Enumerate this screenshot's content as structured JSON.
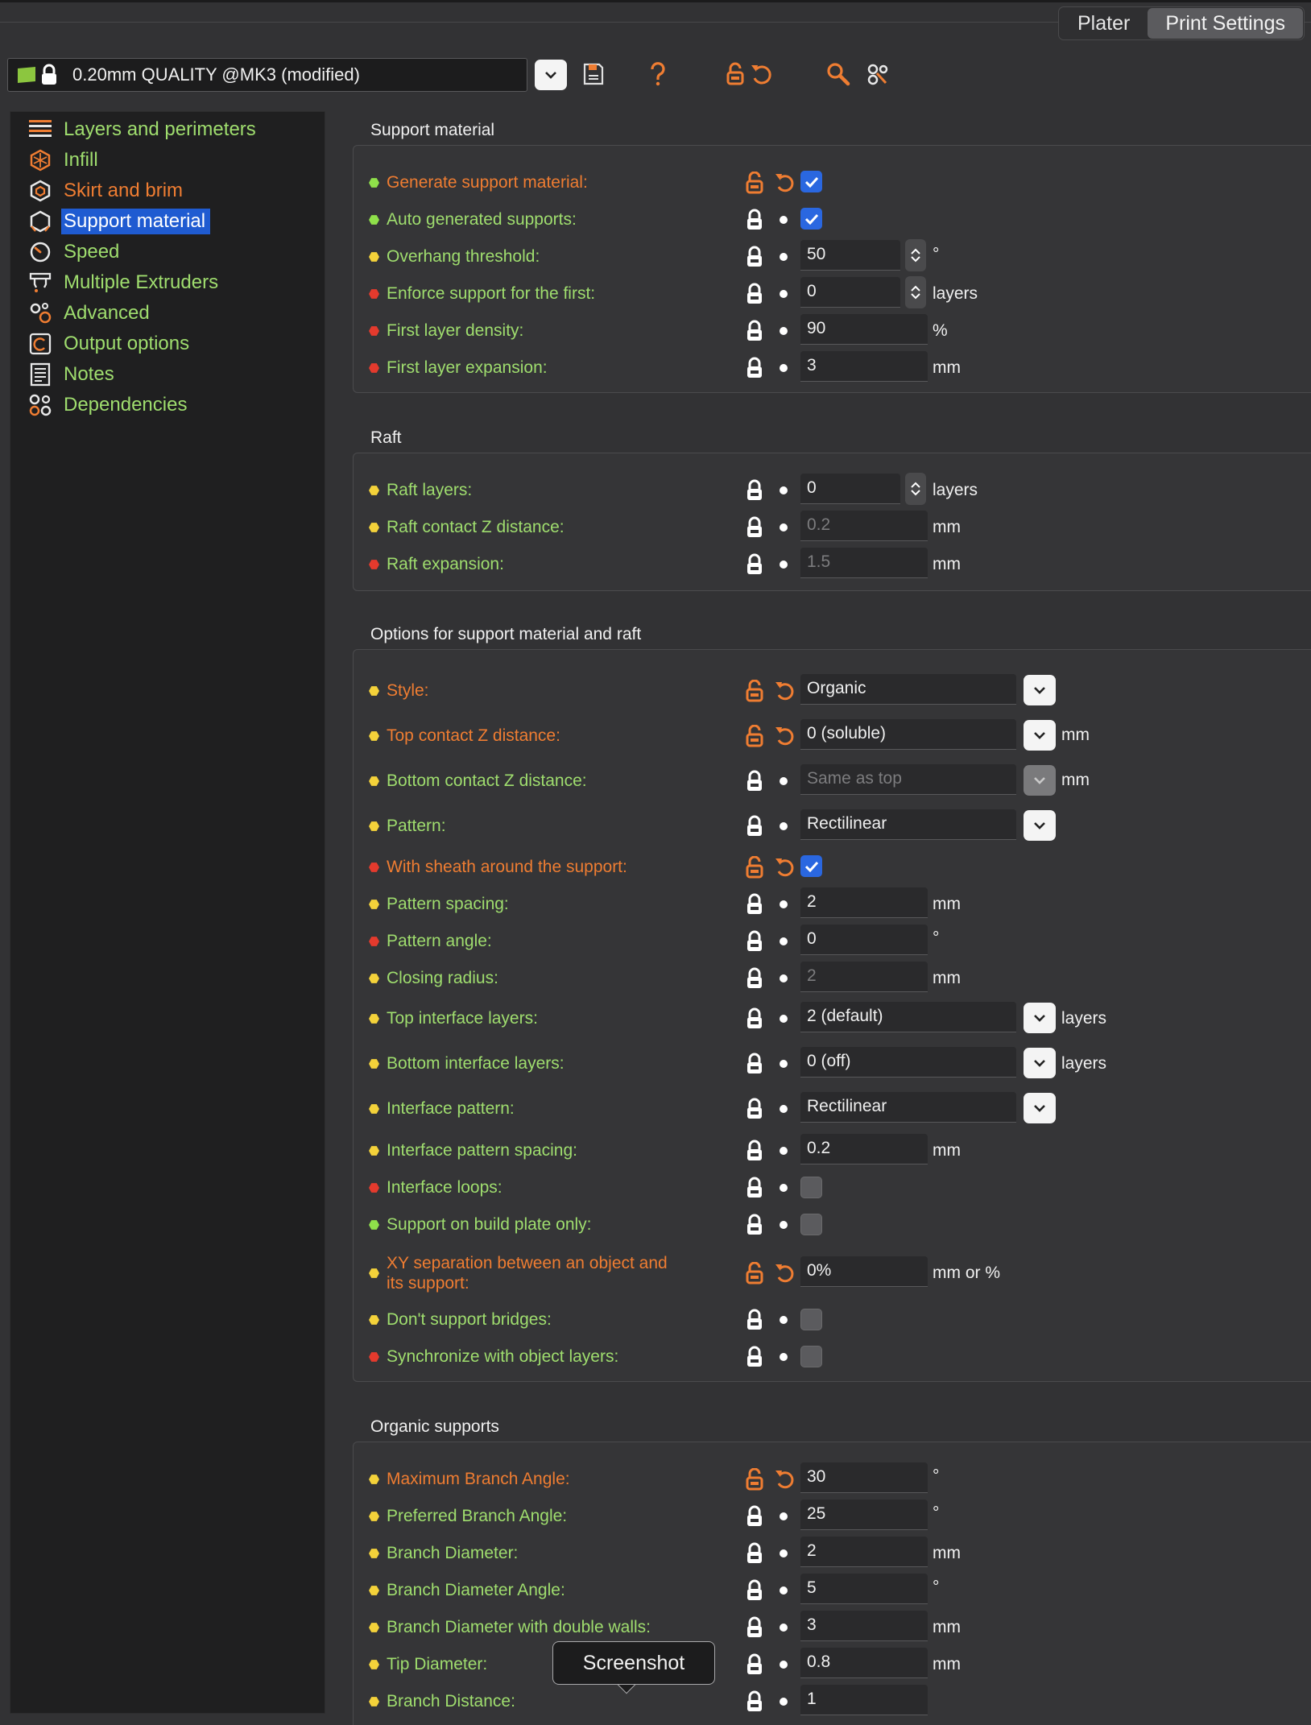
{
  "header": {
    "tabs": [
      {
        "label": "Plater",
        "active": false
      },
      {
        "label": "Print Settings",
        "active": true
      }
    ],
    "preset": {
      "name": "0.20mm QUALITY @MK3 (modified)"
    }
  },
  "sidebar": {
    "items": [
      {
        "label": "Layers and perimeters",
        "icon": "layers-icon"
      },
      {
        "label": "Infill",
        "icon": "infill-icon"
      },
      {
        "label": "Skirt and brim",
        "icon": "skirt-brim-icon"
      },
      {
        "label": "Support material",
        "icon": "support-icon",
        "selected": true
      },
      {
        "label": "Speed",
        "icon": "speed-icon"
      },
      {
        "label": "Multiple Extruders",
        "icon": "extruders-icon"
      },
      {
        "label": "Advanced",
        "icon": "advanced-icon"
      },
      {
        "label": "Output options",
        "icon": "output-icon"
      },
      {
        "label": "Notes",
        "icon": "notes-icon"
      },
      {
        "label": "Dependencies",
        "icon": "dependencies-icon"
      }
    ]
  },
  "sections": {
    "support": {
      "title": "Support material",
      "rows": [
        {
          "label": "Generate support material:",
          "value": "",
          "unit": ""
        },
        {
          "label": "Auto generated supports:",
          "value": "",
          "unit": ""
        },
        {
          "label": "Overhang threshold:",
          "value": "50",
          "unit": "°"
        },
        {
          "label": "Enforce support for the first:",
          "value": "0",
          "unit": "layers"
        },
        {
          "label": "First layer density:",
          "value": "90",
          "unit": "%"
        },
        {
          "label": "First layer expansion:",
          "value": "3",
          "unit": "mm"
        }
      ]
    },
    "raft": {
      "title": "Raft",
      "rows": [
        {
          "label": "Raft layers:",
          "value": "0",
          "unit": "layers"
        },
        {
          "label": "Raft contact Z distance:",
          "value": "0.2",
          "unit": "mm"
        },
        {
          "label": "Raft expansion:",
          "value": "1.5",
          "unit": "mm"
        }
      ]
    },
    "options": {
      "title": "Options for support material and raft",
      "rows": [
        {
          "label": "Style:",
          "value": "Organic",
          "unit": ""
        },
        {
          "label": "Top contact Z distance:",
          "value": "0 (soluble)",
          "unit": "mm"
        },
        {
          "label": "Bottom contact Z distance:",
          "value": "Same as top",
          "unit": "mm"
        },
        {
          "label": "Pattern:",
          "value": "Rectilinear",
          "unit": ""
        },
        {
          "label": "With sheath around the support:",
          "value": "",
          "unit": ""
        },
        {
          "label": "Pattern spacing:",
          "value": "2",
          "unit": "mm"
        },
        {
          "label": "Pattern angle:",
          "value": "0",
          "unit": "°"
        },
        {
          "label": "Closing radius:",
          "value": "2",
          "unit": "mm"
        },
        {
          "label": "Top interface layers:",
          "value": "2 (default)",
          "unit": "layers"
        },
        {
          "label": "Bottom interface layers:",
          "value": "0 (off)",
          "unit": "layers"
        },
        {
          "label": "Interface pattern:",
          "value": "Rectilinear",
          "unit": ""
        },
        {
          "label": "Interface pattern spacing:",
          "value": "0.2",
          "unit": "mm"
        },
        {
          "label": "Interface loops:",
          "value": "",
          "unit": ""
        },
        {
          "label": "Support on build plate only:",
          "value": "",
          "unit": ""
        },
        {
          "label": "XY separation between an object and",
          "label2": "its support:",
          "value": "0%",
          "unit": "mm or %"
        },
        {
          "label": "Don't support bridges:",
          "value": "",
          "unit": ""
        },
        {
          "label": "Synchronize with object layers:",
          "value": "",
          "unit": ""
        }
      ]
    },
    "organic": {
      "title": "Organic supports",
      "rows": [
        {
          "label": "Maximum Branch Angle:",
          "value": "30",
          "unit": "°"
        },
        {
          "label": "Preferred Branch Angle:",
          "value": "25",
          "unit": "°"
        },
        {
          "label": "Branch Diameter:",
          "value": "2",
          "unit": "mm"
        },
        {
          "label": "Branch Diameter Angle:",
          "value": "5",
          "unit": "°"
        },
        {
          "label": "Branch Diameter with double walls:",
          "value": "3",
          "unit": "mm"
        },
        {
          "label": "Tip Diameter:",
          "value": "0.8",
          "unit": "mm"
        },
        {
          "label": "Branch Distance:",
          "value": "1",
          "unit": ""
        }
      ]
    }
  },
  "tooltip": {
    "text": "Screenshot"
  },
  "colors": {
    "accent_blue": "#1f5bd1",
    "label_green": "#9fdd6e",
    "modified_orange": "#ef7d32",
    "mode_simple": "#8fe04a",
    "mode_advanced": "#f4d23a",
    "mode_expert": "#e43a2d"
  }
}
